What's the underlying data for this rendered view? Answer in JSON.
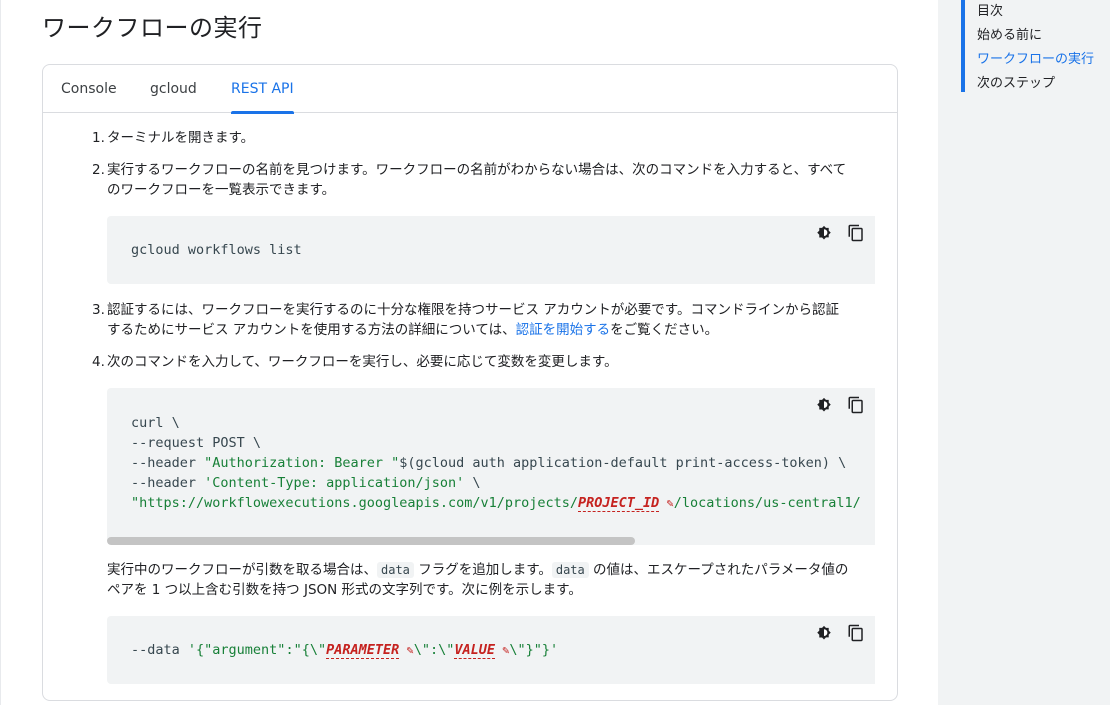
{
  "page": {
    "title": "ワークフローの実行"
  },
  "tabs": [
    {
      "label": "Console"
    },
    {
      "label": "gcloud"
    },
    {
      "label": "REST API"
    }
  ],
  "steps": {
    "s1": {
      "num": "1.",
      "text": "ターミナルを開きます。"
    },
    "s2": {
      "num": "2.",
      "line1": "実行するワークフローの名前を見つけます。ワークフローの名前がわからない場合は、次のコマンドを入力すると、すべて",
      "line2": "のワークフローを一覧表示できます。"
    },
    "s3": {
      "num": "3.",
      "line1": "認証するには、ワークフローを実行するのに十分な権限を持つサービス アカウントが必要です。コマンドラインから認証",
      "line2_pre": "するためにサービス アカウントを使用する方法の詳細については、",
      "link": "認証を開始する",
      "line2_post": "をご覧ください。"
    },
    "s4": {
      "num": "4.",
      "text": "次のコマンドを入力して、ワークフローを実行し、必要に応じて変数を変更します。"
    }
  },
  "code1": {
    "line": "gcloud workflows list"
  },
  "code2": {
    "l1": "curl \\",
    "l2": "--request POST \\",
    "l3_pre": "--header ",
    "l3_str1": "\"Authorization: Bearer \"",
    "l3_rest": "$(gcloud auth application-default print-access-token) \\",
    "l4_pre": "--header ",
    "l4_str": "'Content-Type: application/json'",
    "l4_post": " \\",
    "l5_str1": "\"https://workflowexecutions.googleapis.com/v1/projects/",
    "l5_ph": "PROJECT_ID",
    "l5_str2": "/locations/us-central1/"
  },
  "para": {
    "line1_a": "実行中のワークフローが引数を取る場合は、",
    "code_a": "data",
    "line1_b": " フラグを追加します。",
    "code_b": "data",
    "line1_c": " の値は、エスケープされたパラメータ値の",
    "line2": "ペアを 1 つ以上含む引数を持つ JSON 形式の文字列です。次に例を示します。"
  },
  "code3": {
    "pre": "--data ",
    "str1": "'{\"argument\":\"{\\\"",
    "ph1": "PARAMETER",
    "str2": "\\\":\\\"",
    "ph2": "VALUE",
    "str3": "\\\"}\"}'"
  },
  "toc": {
    "title": "目次",
    "items": [
      {
        "label": "始める前に"
      },
      {
        "label": "ワークフローの実行"
      },
      {
        "label": "次のステップ"
      }
    ]
  },
  "colors": {
    "accent": "#1a73e8",
    "string": "#188038",
    "placeholder": "#c5221f",
    "code_bg": "#f1f3f4"
  }
}
